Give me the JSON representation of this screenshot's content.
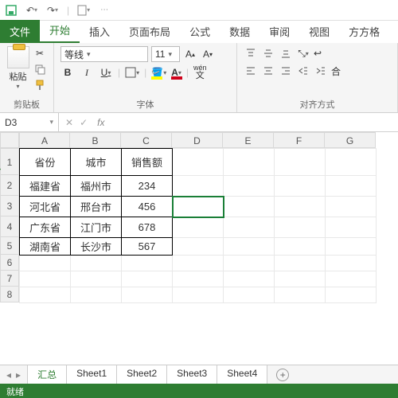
{
  "titlebar": {
    "save_icon": "save",
    "undo_icon": "undo",
    "redo_icon": "redo",
    "doc_icon": "doc"
  },
  "tabs": {
    "file": "文件",
    "items": [
      "开始",
      "插入",
      "页面布局",
      "公式",
      "数据",
      "审阅",
      "视图",
      "方方格"
    ],
    "active_index": 0
  },
  "ribbon": {
    "clipboard": {
      "paste": "粘贴",
      "label": "剪贴板"
    },
    "font": {
      "name": "等线",
      "size": "11",
      "b": "B",
      "i": "I",
      "u": "U",
      "fill_color": "#ffff00",
      "font_color": "#d0021b",
      "wenA": "wén",
      "label": "字体"
    },
    "align": {
      "merge": "合",
      "label": "对齐方式"
    }
  },
  "fx": {
    "cell": "D3",
    "formula": ""
  },
  "columns": [
    "A",
    "B",
    "C",
    "D",
    "E",
    "F",
    "G"
  ],
  "rows": [
    "1",
    "2",
    "3",
    "4",
    "5",
    "6",
    "7",
    "8"
  ],
  "table": {
    "headers": [
      "省份",
      "城市",
      "销售额"
    ],
    "rows": [
      [
        "福建省",
        "福州市",
        "234"
      ],
      [
        "河北省",
        "邢台市",
        "456"
      ],
      [
        "广东省",
        "江门市",
        "678"
      ],
      [
        "湖南省",
        "长沙市",
        "567"
      ]
    ]
  },
  "selected": {
    "col": 3,
    "row": 2
  },
  "sheet_tabs": {
    "items": [
      "汇总",
      "Sheet1",
      "Sheet2",
      "Sheet3",
      "Sheet4"
    ],
    "active_index": 0
  },
  "status": "就绪",
  "chart_data": {
    "type": "table",
    "columns": [
      "省份",
      "城市",
      "销售额"
    ],
    "rows": [
      [
        "福建省",
        "福州市",
        234
      ],
      [
        "河北省",
        "邢台市",
        456
      ],
      [
        "广东省",
        "江门市",
        678
      ],
      [
        "湖南省",
        "长沙市",
        567
      ]
    ]
  }
}
